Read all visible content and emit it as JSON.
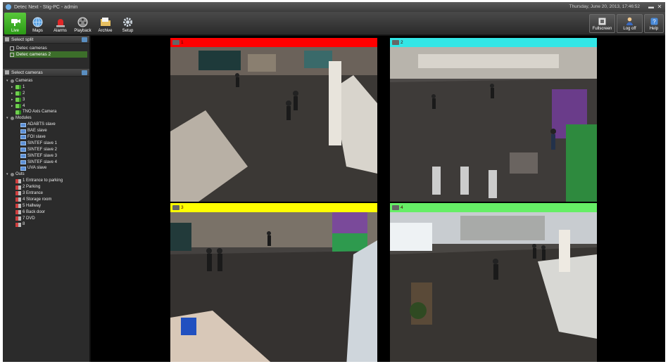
{
  "window": {
    "title": "Detec Next - Stig-PC - admin",
    "datetime": "Thursday, June 20, 2013, 17:46:52"
  },
  "toolbar": {
    "left": [
      {
        "label": "Live",
        "icon": "live-camera-icon",
        "active": true
      },
      {
        "label": "Maps",
        "icon": "globe-icon",
        "active": false
      },
      {
        "label": "Alarms",
        "icon": "alarm-siren-icon",
        "active": false
      },
      {
        "label": "Playback",
        "icon": "film-reel-icon",
        "active": false
      },
      {
        "label": "Archive",
        "icon": "folder-icon",
        "active": false
      },
      {
        "label": "Setup",
        "icon": "gear-icon",
        "active": false
      }
    ],
    "right": [
      {
        "label": "Fullscreen",
        "icon": "fullscreen-icon"
      },
      {
        "label": "Log off",
        "icon": "user-icon"
      },
      {
        "label": "Help",
        "icon": "help-icon"
      }
    ]
  },
  "select_split": {
    "title": "Select split",
    "items": [
      {
        "label": "Detec cameras",
        "selected": false
      },
      {
        "label": "Detec cameras 2",
        "selected": true
      }
    ]
  },
  "select_cameras": {
    "title": "Select cameras",
    "tree": [
      {
        "label": "Cameras",
        "level": 1,
        "kind": "group",
        "expander": "▾"
      },
      {
        "label": "1",
        "level": 2,
        "kind": "cam",
        "expander": "▸"
      },
      {
        "label": "2",
        "level": 2,
        "kind": "cam",
        "expander": "▸"
      },
      {
        "label": "3",
        "level": 2,
        "kind": "cam",
        "expander": "▸"
      },
      {
        "label": "4",
        "level": 2,
        "kind": "cam",
        "expander": "▸"
      },
      {
        "label": "TNO Axis Camera",
        "level": 2,
        "kind": "cam",
        "expander": ""
      },
      {
        "label": "Modules",
        "level": 1,
        "kind": "group",
        "expander": "▾"
      },
      {
        "label": "ADABTS slave",
        "level": 3,
        "kind": "mod",
        "expander": ""
      },
      {
        "label": "BAE slave",
        "level": 3,
        "kind": "mod",
        "expander": ""
      },
      {
        "label": "FOI slave",
        "level": 3,
        "kind": "mod",
        "expander": ""
      },
      {
        "label": "SINTEF slave 1",
        "level": 3,
        "kind": "mod",
        "expander": ""
      },
      {
        "label": "SINTEF slave 2",
        "level": 3,
        "kind": "mod",
        "expander": ""
      },
      {
        "label": "SINTEF slave 3",
        "level": 3,
        "kind": "mod",
        "expander": ""
      },
      {
        "label": "SINTEF slave 4",
        "level": 3,
        "kind": "mod",
        "expander": ""
      },
      {
        "label": "UVA slave",
        "level": 3,
        "kind": "mod",
        "expander": ""
      },
      {
        "label": "Outs",
        "level": 1,
        "kind": "group",
        "expander": "▾"
      },
      {
        "label": "1 Entrance to parking",
        "level": 2,
        "kind": "out",
        "expander": ""
      },
      {
        "label": "2 Parking",
        "level": 2,
        "kind": "out",
        "expander": ""
      },
      {
        "label": "3 Entrance",
        "level": 2,
        "kind": "out",
        "expander": ""
      },
      {
        "label": "4 Storage room",
        "level": 2,
        "kind": "out",
        "expander": ""
      },
      {
        "label": "5 Hallway",
        "level": 2,
        "kind": "out",
        "expander": ""
      },
      {
        "label": "6 Back door",
        "level": 2,
        "kind": "out",
        "expander": ""
      },
      {
        "label": "7 DVD",
        "level": 2,
        "kind": "out",
        "expander": ""
      },
      {
        "label": "8",
        "level": 2,
        "kind": "out",
        "expander": ""
      }
    ]
  },
  "tiles": [
    {
      "number": "1",
      "bar_color": "#ff0000",
      "scene": "atrium-escalator"
    },
    {
      "number": "2",
      "bar_color": "#33e6e6",
      "scene": "reception-gates"
    },
    {
      "number": "3",
      "bar_color": "#ffff00",
      "scene": "hall-people"
    },
    {
      "number": "4",
      "bar_color": "#66ee66",
      "scene": "hall-fisheye"
    }
  ]
}
